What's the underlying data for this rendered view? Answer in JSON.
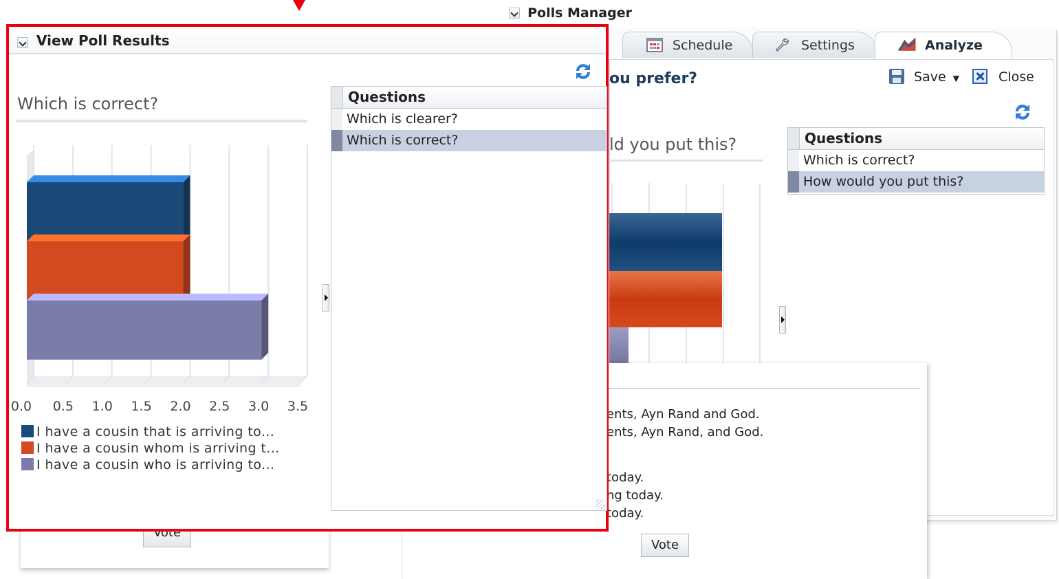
{
  "polls_manager": {
    "title": "Polls Manager",
    "tabs": [
      {
        "label": "Schedule",
        "icon": "calendar-icon"
      },
      {
        "label": "Settings",
        "icon": "wrench-icon"
      },
      {
        "label": "Analyze",
        "icon": "chart-icon",
        "active": true
      }
    ],
    "toolbar": {
      "save_label": "Save",
      "close_label": "Close"
    },
    "question_heading_fragment": "ou prefer?",
    "chart_question_fragment": "ld you put this?",
    "questions_panel": {
      "header": "Questions",
      "items": [
        "Which is correct?",
        "How would you put this?"
      ],
      "selected_index": 1
    },
    "colors": {
      "series1": "#1b4a78",
      "series2": "#d24a1e",
      "series3": "#7b7caa"
    }
  },
  "background_vote_widget": {
    "answers": [
      "ents, Ayn Rand and God.",
      "ents, Ayn Rand, and God.",
      "today.",
      "ng today.",
      "today."
    ],
    "vote_label": "Vote",
    "left_vote_label_fragment": "Vote"
  },
  "view_poll_results": {
    "title": "View Poll Results",
    "question": "Which is correct?",
    "questions_panel": {
      "header": "Questions",
      "items": [
        "Which is clearer?",
        "Which is correct?"
      ],
      "selected_index": 1
    },
    "accent_border_color": "#e8000f"
  },
  "chart_data": {
    "type": "bar",
    "orientation": "horizontal",
    "stacked": false,
    "title": "Which is correct?",
    "x_ticks": [
      "0.0",
      "0.5",
      "1.0",
      "1.5",
      "2.0",
      "2.5",
      "3.0",
      "3.5"
    ],
    "xlim": [
      0,
      3.5
    ],
    "grid": true,
    "legend_position": "bottom",
    "series": [
      {
        "name": "I have a cousin that is arriving to...",
        "value": 2,
        "color": "#1b4a78"
      },
      {
        "name": "I have a cousin whom is arriving t...",
        "value": 2,
        "color": "#d24a1e"
      },
      {
        "name": "I have a cousin who is arriving to...",
        "value": 3,
        "color": "#7b7caa"
      }
    ]
  }
}
